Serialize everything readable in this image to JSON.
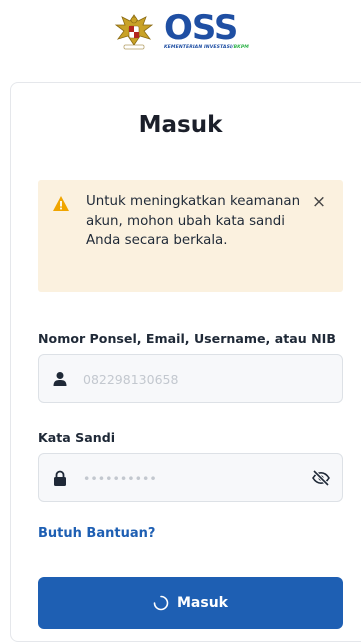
{
  "header": {
    "logo_text": "OSS",
    "logo_subtitle_main": "KEMENTERIAN INVESTASI/",
    "logo_subtitle_accent": "BKPM",
    "brand_color": "#1f4fa3",
    "accent_color": "#2fb34a"
  },
  "login": {
    "title": "Masuk",
    "alert": {
      "icon": "warning-icon",
      "message": "Untuk meningkatkan keamanan akun, mohon ubah kata sandi Anda secara berkala.",
      "close_label": "×",
      "background_color": "#fbf1df",
      "icon_color": "#f0a500"
    },
    "identifier": {
      "label": "Nomor Ponsel, Email, Username, atau NIB",
      "placeholder": "082298130658",
      "value": "",
      "icon": "user-icon"
    },
    "password": {
      "label": "Kata Sandi",
      "placeholder": "••••••••••",
      "value": "",
      "icon": "lock-icon",
      "visibility_icon": "eye-slash-icon"
    },
    "help_link": "Butuh Bantuan?",
    "submit": {
      "label": "Masuk",
      "icon": "spinner-icon",
      "color": "#1e5fb3"
    }
  }
}
